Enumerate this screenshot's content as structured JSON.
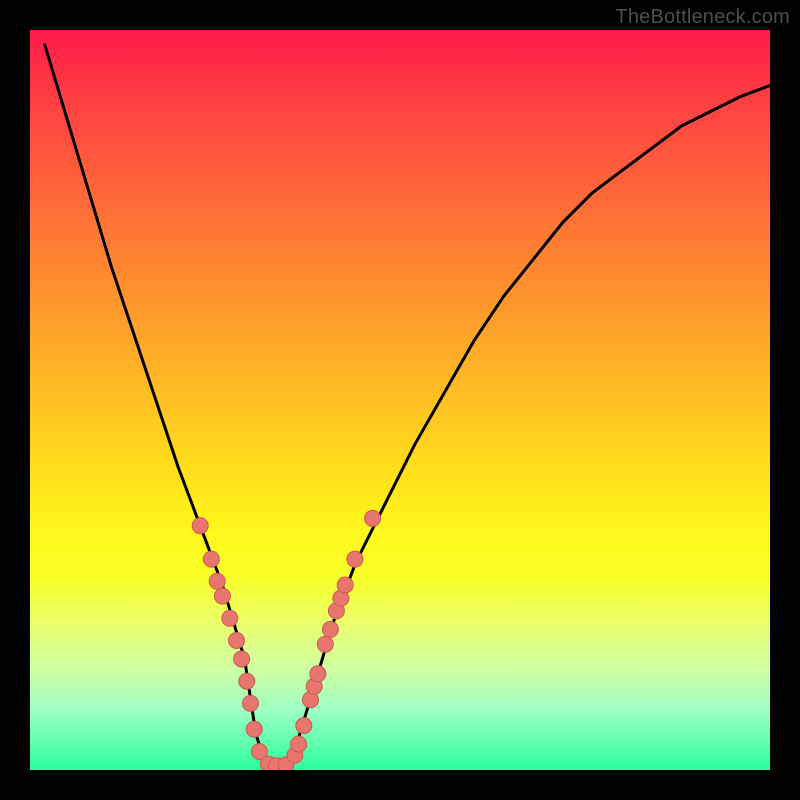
{
  "attribution": "TheBottleneck.com",
  "chart_data": {
    "type": "line",
    "title": "",
    "xlabel": "",
    "ylabel": "",
    "xlim": [
      0,
      100
    ],
    "ylim": [
      0,
      100
    ],
    "grid": false,
    "legend": false,
    "series": [
      {
        "name": "curve",
        "x": [
          2,
          5,
          8,
          11,
          14,
          17,
          20,
          23,
          26,
          29,
          30.5,
          32,
          35,
          38,
          41,
          44,
          48,
          52,
          56,
          60,
          64,
          68,
          72,
          76,
          80,
          84,
          88,
          92,
          96,
          100
        ],
        "y": [
          98,
          88,
          78,
          68,
          59,
          50,
          41,
          33,
          25,
          15,
          5,
          0,
          0,
          10,
          20,
          28,
          36,
          44,
          51,
          58,
          64,
          69,
          74,
          78,
          81,
          84,
          87,
          89,
          91,
          92.5
        ]
      }
    ],
    "markers": [
      {
        "x": 23,
        "y": 33
      },
      {
        "x": 24.5,
        "y": 28.5
      },
      {
        "x": 25.3,
        "y": 25.5
      },
      {
        "x": 26,
        "y": 23.5
      },
      {
        "x": 27,
        "y": 20.5
      },
      {
        "x": 27.9,
        "y": 17.5
      },
      {
        "x": 28.6,
        "y": 15
      },
      {
        "x": 29.3,
        "y": 12
      },
      {
        "x": 29.8,
        "y": 9
      },
      {
        "x": 30.3,
        "y": 5.5
      },
      {
        "x": 31,
        "y": 2.5
      },
      {
        "x": 32.2,
        "y": 0.8
      },
      {
        "x": 33.3,
        "y": 0.6
      },
      {
        "x": 34.6,
        "y": 0.7
      },
      {
        "x": 35.8,
        "y": 2
      },
      {
        "x": 36.3,
        "y": 3.5
      },
      {
        "x": 37,
        "y": 6
      },
      {
        "x": 37.9,
        "y": 9.5
      },
      {
        "x": 38.4,
        "y": 11.3
      },
      {
        "x": 38.9,
        "y": 13
      },
      {
        "x": 39.9,
        "y": 17
      },
      {
        "x": 40.6,
        "y": 19
      },
      {
        "x": 41.4,
        "y": 21.5
      },
      {
        "x": 42,
        "y": 23.2
      },
      {
        "x": 42.6,
        "y": 25
      },
      {
        "x": 43.9,
        "y": 28.5
      },
      {
        "x": 46.3,
        "y": 34
      }
    ],
    "marker_style": {
      "fill": "#e8766e",
      "stroke": "#c85a52",
      "r": 8
    }
  }
}
